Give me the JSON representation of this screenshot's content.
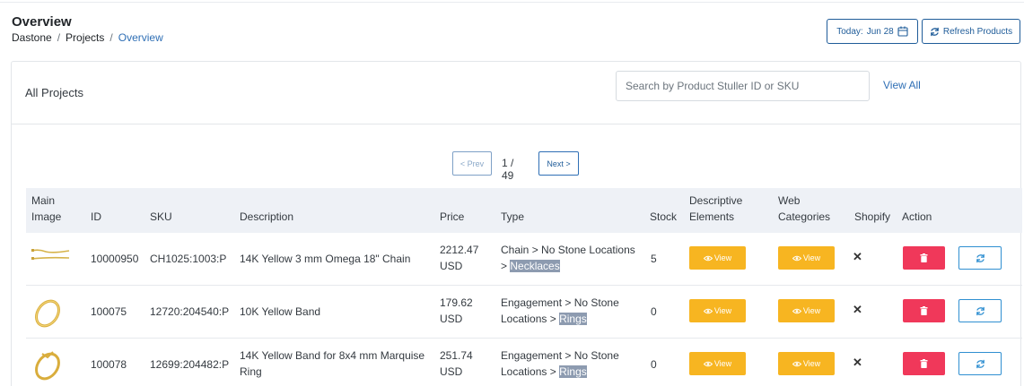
{
  "header": {
    "title": "Overview",
    "breadcrumb": [
      "Dastone",
      "Projects",
      "Overview"
    ],
    "today_label": "Today:",
    "today_date": "Jun 28",
    "refresh_label": "Refresh Products"
  },
  "card": {
    "title": "All Projects",
    "search_placeholder": "Search by Product Stuller ID or SKU",
    "view_all": "View All"
  },
  "pagination": {
    "prev": "< Prev",
    "next": "Next >",
    "info": "1 / 49"
  },
  "table": {
    "headers": {
      "image_1": "Main",
      "image_2": "Image",
      "id": "ID",
      "sku": "SKU",
      "description": "Description",
      "price": "Price",
      "type": "Type",
      "stock": "Stock",
      "desc_el_1": "Descriptive",
      "desc_el_2": "Elements",
      "web_cat_1": "Web",
      "web_cat_2": "Categories",
      "shopify": "Shopify",
      "action": "Action"
    },
    "view_label": "View",
    "rows": [
      {
        "image_icon": "chain-thumbnail",
        "id": "10000950",
        "sku": "CH1025:1003:P",
        "description_1": "14K Yellow 3 mm Omega 18\" Chain",
        "description_2": "",
        "price": "2212.47",
        "currency": "USD",
        "type_1": "Chain > No Stone Locations",
        "type_2_prefix": ">",
        "type_2_hl": "Necklaces",
        "stock": "5",
        "shopify": "✕"
      },
      {
        "image_icon": "ring-thumbnail",
        "id": "100075",
        "sku": "12720:204540:P",
        "description_1": "10K Yellow Band",
        "description_2": "",
        "price": "179.62",
        "currency": "USD",
        "type_1": "Engagement > No Stone",
        "type_2_prefix": "Locations >",
        "type_2_hl": "Rings",
        "stock": "0",
        "shopify": "✕"
      },
      {
        "image_icon": "ring-thumbnail",
        "id": "100078",
        "sku": "12699:204482:P",
        "description_1": "14K Yellow Band for 8x4 mm Marquise",
        "description_2": "Ring",
        "price": "251.74",
        "currency": "USD",
        "type_1": "Engagement > No Stone",
        "type_2_prefix": "Locations >",
        "type_2_hl": "Rings",
        "stock": "0",
        "shopify": "✕"
      }
    ]
  },
  "colors": {
    "accent": "#2f6fb5",
    "view_button": "#f7b521",
    "delete_button": "#f0385a",
    "header_bg": "#eef1f6"
  }
}
